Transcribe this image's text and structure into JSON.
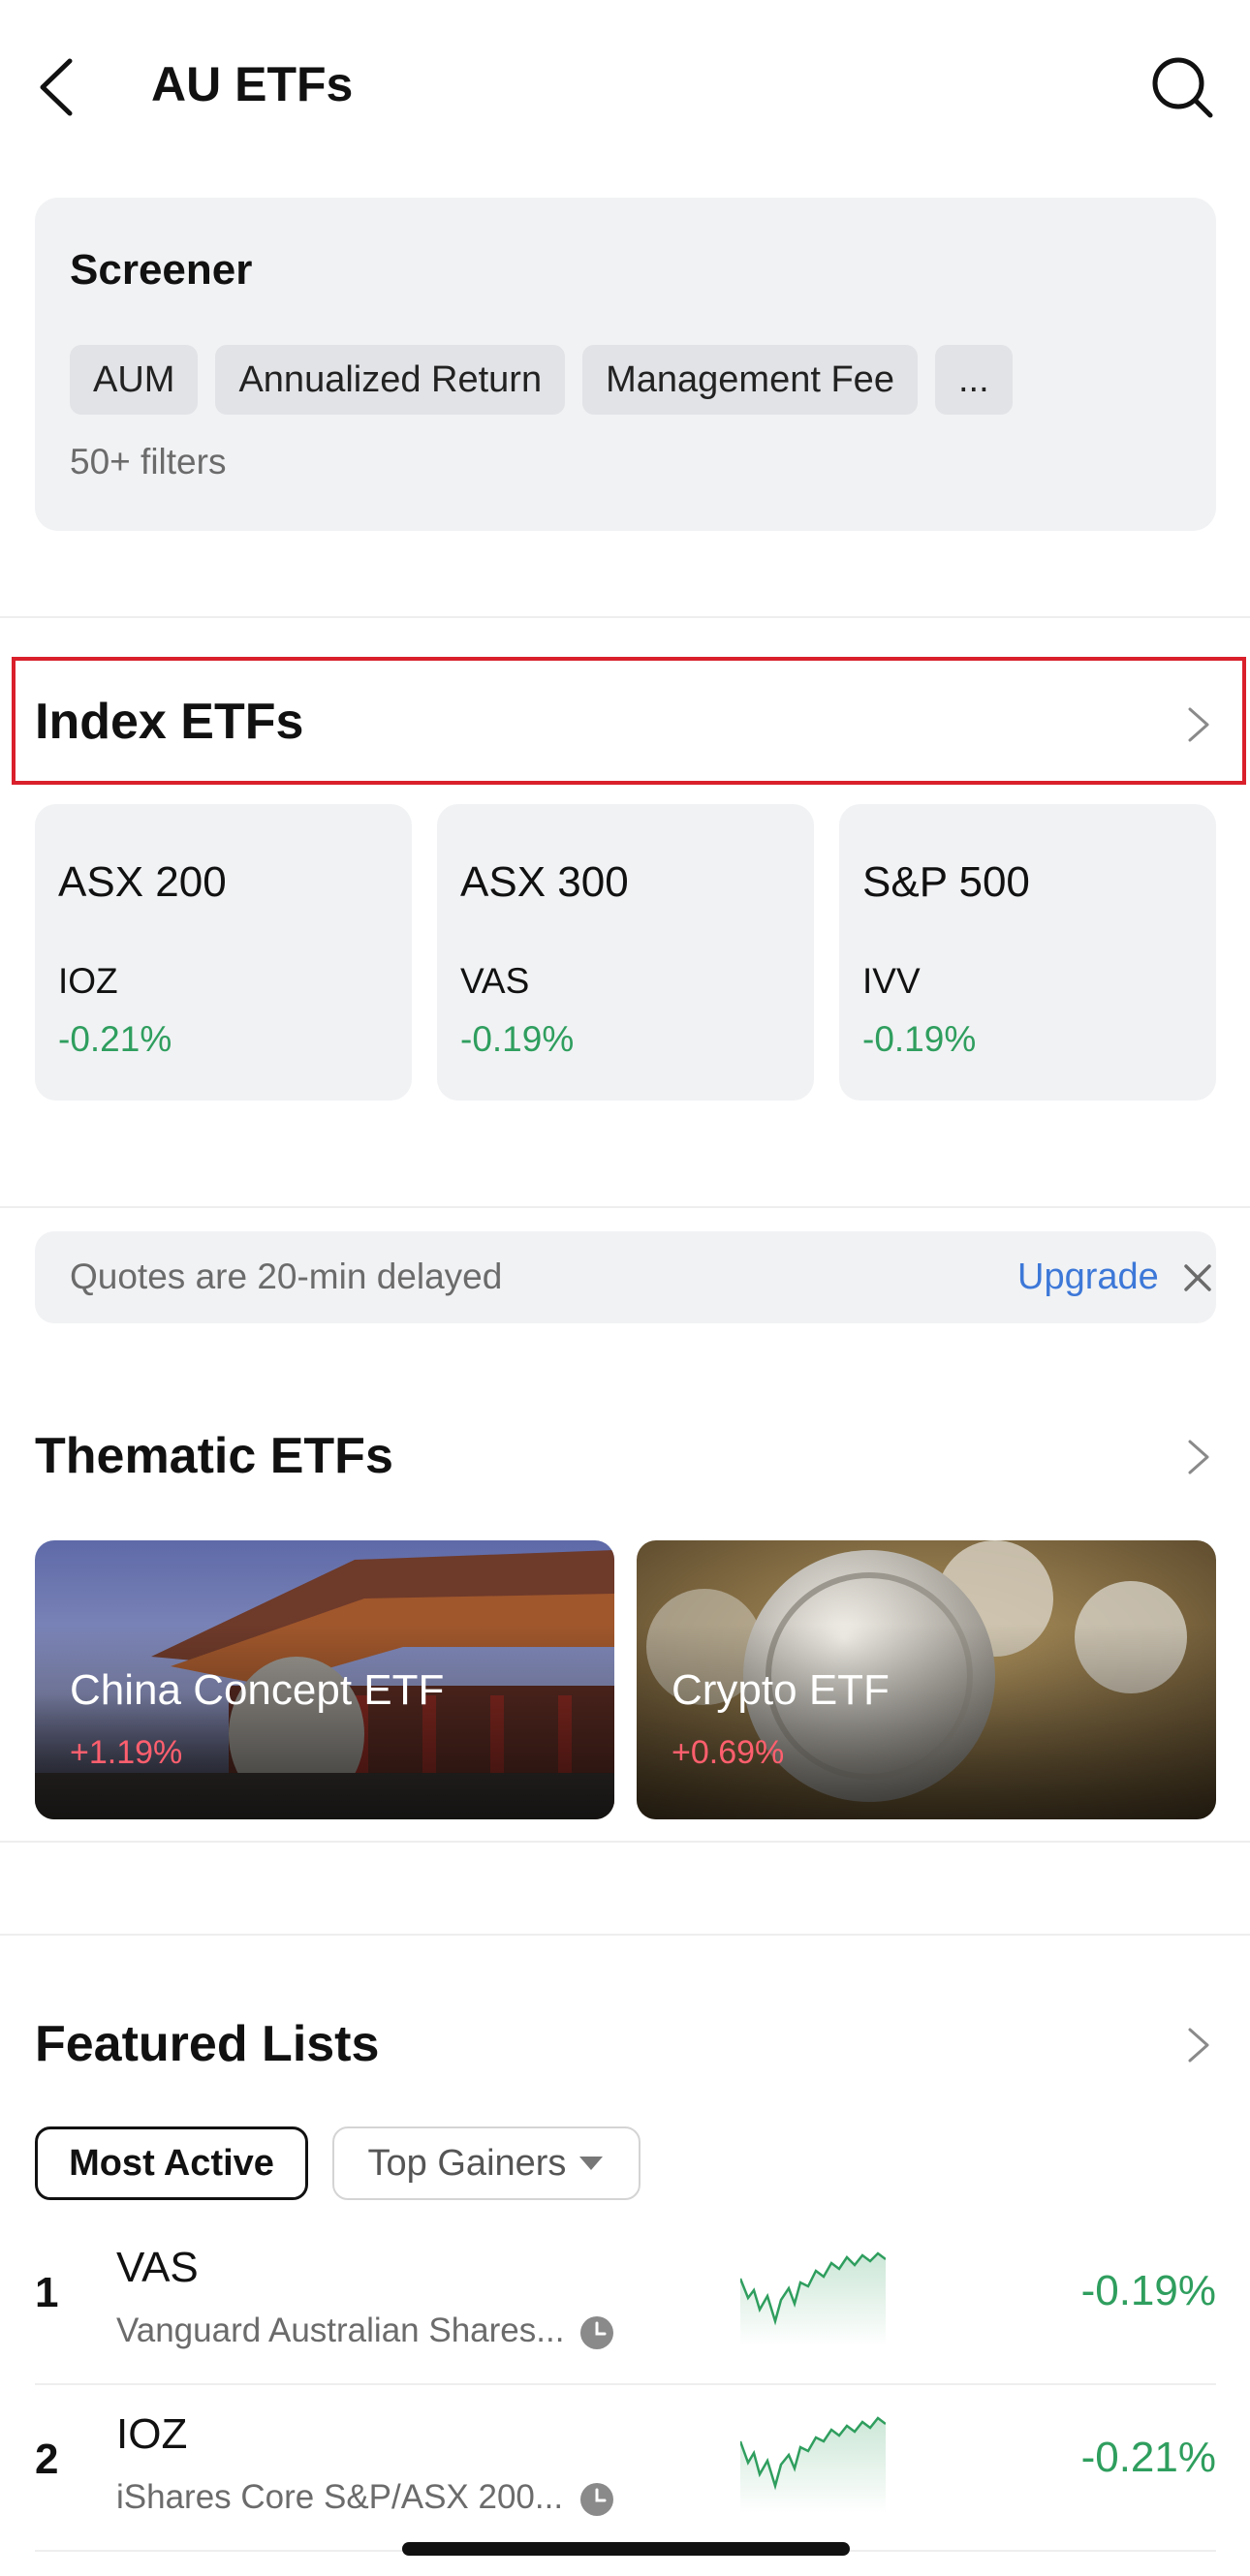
{
  "header": {
    "title": "AU ETFs",
    "back_icon": "chevron-left-icon",
    "search_icon": "search-icon"
  },
  "screener": {
    "title": "Screener",
    "chips": [
      "AUM",
      "Annualized Return",
      "Management Fee",
      "..."
    ],
    "filters_count": "50+ filters"
  },
  "index_etfs": {
    "title": "Index ETFs",
    "cards": [
      {
        "index": "ASX 200",
        "ticker": "IOZ",
        "change": "-0.21%"
      },
      {
        "index": "ASX 300",
        "ticker": "VAS",
        "change": "-0.19%"
      },
      {
        "index": "S&P 500",
        "ticker": "IVV",
        "change": "-0.19%"
      }
    ]
  },
  "notice": {
    "text": "Quotes are 20-min delayed",
    "upgrade": "Upgrade"
  },
  "thematic": {
    "title": "Thematic ETFs",
    "cards": [
      {
        "name": "China Concept ETF",
        "change": "+1.19%"
      },
      {
        "name": "Crypto ETF",
        "change": "+0.69%"
      }
    ]
  },
  "featured": {
    "title": "Featured Lists",
    "tabs": [
      "Most Active",
      "Top Gainers"
    ],
    "rows": [
      {
        "rank": "1",
        "symbol": "VAS",
        "name": "Vanguard Australian Shares...",
        "change": "-0.19%"
      },
      {
        "rank": "2",
        "symbol": "IOZ",
        "name": "iShares Core S&P/ASX 200...",
        "change": "-0.21%"
      }
    ]
  },
  "colors": {
    "negative": "#2f9e5e",
    "positive": "#ff5f6e",
    "link": "#3d78d8",
    "highlight": "#d9202b",
    "card_bg": "#f1f2f4"
  }
}
